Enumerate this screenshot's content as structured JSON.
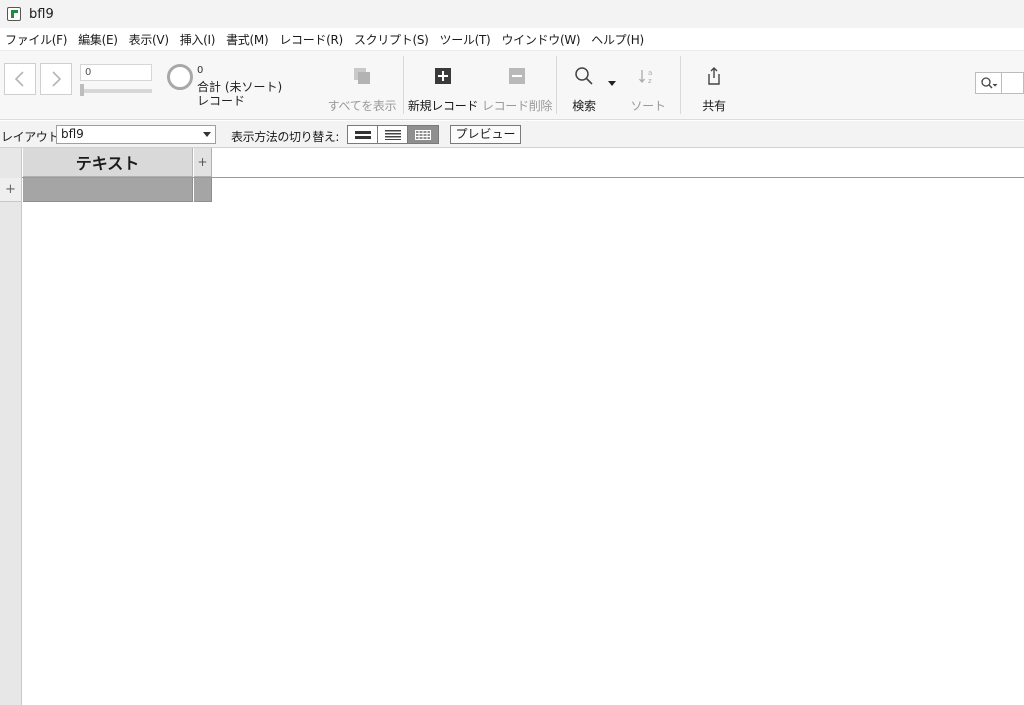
{
  "window": {
    "title": "bfl9"
  },
  "menu": [
    "ファイル(F)",
    "編集(E)",
    "表示(V)",
    "挿入(I)",
    "書式(M)",
    "レコード(R)",
    "スクリプト(S)",
    "ツール(T)",
    "ウインドウ(W)",
    "ヘルプ(H)"
  ],
  "toolbar": {
    "record_number": "0",
    "found_count": "0",
    "total_label": "合計 (未ソート)",
    "records_label": "レコード",
    "show_all": "すべてを表示",
    "new_record": "新規レコード",
    "delete_record": "レコード削除",
    "find": "検索",
    "sort": "ソート",
    "share": "共有"
  },
  "layout_bar": {
    "layout_label": "レイアウト:",
    "layout_value": "bfl9",
    "view_as_label": "表示方法の切り替え:",
    "view_modes": [
      "form",
      "list",
      "table"
    ],
    "active_view": "table",
    "preview": "プレビュー"
  },
  "table": {
    "columns": [
      "テキスト"
    ],
    "add_field": "+",
    "add_record": "+"
  }
}
